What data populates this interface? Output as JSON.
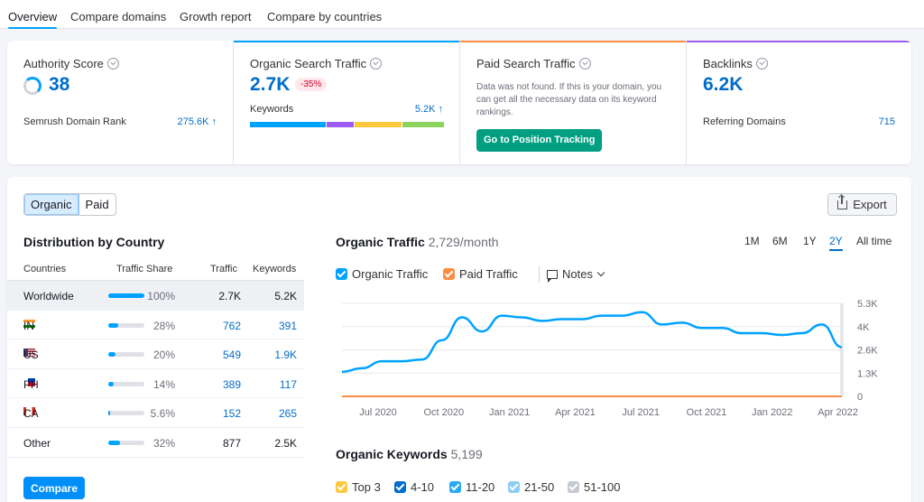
{
  "tabs": [
    {
      "label": "Overview",
      "active": true
    },
    {
      "label": "Compare domains"
    },
    {
      "label": "Growth report"
    },
    {
      "label": "Compare by countries"
    }
  ],
  "cards": {
    "authority": {
      "title": "Authority Score",
      "value": "38",
      "rank_label": "Semrush Domain Rank",
      "rank_value": "275.6K ↑"
    },
    "organic": {
      "title": "Organic Search Traffic",
      "value": "2.7K",
      "change": "-35%",
      "keywords_label": "Keywords",
      "keywords_value": "5.2K ↑",
      "accent": "#00a2ff"
    },
    "paid": {
      "title": "Paid Search Traffic",
      "note": "Data was not found. If this is your domain, you can get all the necessary data on its keyword rankings.",
      "button": "Go to Position Tracking",
      "accent": "#ff8c43"
    },
    "backlinks": {
      "title": "Backlinks",
      "value": "6.2K",
      "ref_label": "Referring Domains",
      "ref_value": "715",
      "accent": "#9d5bf0"
    }
  },
  "toggle": {
    "organic": "Organic",
    "paid": "Paid"
  },
  "export_label": "Export",
  "distribution": {
    "title": "Distribution by Country",
    "headers": {
      "countries": "Countries",
      "share": "Traffic Share",
      "traffic": "Traffic",
      "keywords": "Keywords"
    },
    "rows": [
      {
        "name": "Worldwide",
        "share": 100,
        "share_label": "100%",
        "traffic": "2.7K",
        "keywords": "5.2K"
      },
      {
        "name": "IN",
        "share": 28,
        "share_label": "28%",
        "traffic": "762",
        "keywords": "391"
      },
      {
        "name": "US",
        "share": 20,
        "share_label": "20%",
        "traffic": "549",
        "keywords": "1.9K"
      },
      {
        "name": "PH",
        "share": 14,
        "share_label": "14%",
        "traffic": "389",
        "keywords": "117"
      },
      {
        "name": "CA",
        "share": 5.6,
        "share_label": "5.6%",
        "traffic": "152",
        "keywords": "265"
      },
      {
        "name": "Other",
        "share": 32,
        "share_label": "32%",
        "traffic": "877",
        "keywords": "2.5K"
      }
    ],
    "compare_button": "Compare"
  },
  "organic_traffic": {
    "title": "Organic Traffic",
    "subtitle": "2,729/month",
    "periods": [
      "1M",
      "6M",
      "1Y",
      "2Y",
      "All time"
    ],
    "active_period": "2Y",
    "legend": {
      "organic": "Organic Traffic",
      "paid": "Paid Traffic",
      "notes": "Notes"
    }
  },
  "organic_keywords": {
    "title": "Organic Keywords",
    "subtitle": "5,199",
    "legend": [
      "Top 3",
      "4-10",
      "11-20",
      "21-50",
      "51-100"
    ]
  },
  "chart_data": {
    "type": "line",
    "x": [
      "2020-05",
      "2020-06",
      "2020-07",
      "2020-08",
      "2020-09",
      "2020-10",
      "2020-11",
      "2020-12",
      "2021-01",
      "2021-02",
      "2021-03",
      "2021-04",
      "2021-05",
      "2021-06",
      "2021-07",
      "2021-08",
      "2021-09",
      "2021-10",
      "2021-11",
      "2021-12",
      "2022-01",
      "2022-02",
      "2022-03",
      "2022-04",
      "2022-05"
    ],
    "series": [
      {
        "name": "Organic Traffic",
        "color": "#00a2ff",
        "values": [
          1400,
          1600,
          2000,
          2000,
          2100,
          3200,
          4500,
          3700,
          4600,
          4500,
          4300,
          4400,
          4400,
          4600,
          4600,
          4800,
          4100,
          4200,
          3900,
          3900,
          3600,
          3600,
          3500,
          3600,
          4100,
          2800
        ]
      },
      {
        "name": "Paid Traffic",
        "color": "#ff8c43",
        "values": [
          0,
          0,
          0,
          0,
          0,
          0,
          0,
          0,
          0,
          0,
          0,
          0,
          0,
          0,
          0,
          0,
          0,
          0,
          0,
          0,
          0,
          0,
          0,
          0,
          0,
          0
        ]
      }
    ],
    "x_tick_labels": [
      "Jul 2020",
      "Oct 2020",
      "Jan 2021",
      "Apr 2021",
      "Jul 2021",
      "Oct 2021",
      "Jan 2022",
      "Apr 2022"
    ],
    "y_tick_labels": [
      "5.3K",
      "4K",
      "2.6K",
      "1.3K",
      "0"
    ],
    "ylim": [
      0,
      5300
    ],
    "grid": true
  }
}
